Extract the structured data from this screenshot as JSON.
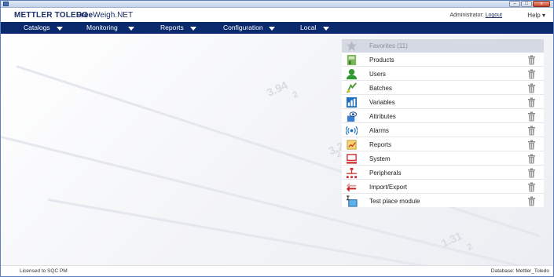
{
  "header": {
    "brand": "METTLER TOLEDO",
    "product_bold": "Free",
    "product_rest": "Weigh.NET",
    "user_label": "Administrator:",
    "logout": "Logout",
    "help": "Help"
  },
  "window_controls": {
    "minimize": "–",
    "maximize": "□",
    "close": "x"
  },
  "nav": {
    "items": [
      {
        "label": "Catalogs"
      },
      {
        "label": "Monitoring"
      },
      {
        "label": "Reports"
      },
      {
        "label": "Configuration"
      },
      {
        "label": "Local"
      }
    ]
  },
  "favorites": {
    "label": "Favorites (11)",
    "icon": "star-icon"
  },
  "modules": [
    {
      "label": "Products",
      "icon": "products-icon"
    },
    {
      "label": "Users",
      "icon": "user-icon"
    },
    {
      "label": "Batches",
      "icon": "batches-icon"
    },
    {
      "label": "Variables",
      "icon": "bar-chart-icon"
    },
    {
      "label": "Attributes",
      "icon": "attributes-icon"
    },
    {
      "label": "Alarms",
      "icon": "alarm-icon"
    },
    {
      "label": "Reports",
      "icon": "reports-icon"
    },
    {
      "label": "System",
      "icon": "system-icon"
    },
    {
      "label": "Peripherals",
      "icon": "peripherals-icon"
    },
    {
      "label": "Import/Export",
      "icon": "import-export-icon"
    },
    {
      "label": "Test place module",
      "icon": "test-place-icon"
    }
  ],
  "background_numbers": [
    "3.94",
    "2",
    "3.2",
    "2",
    "1.31",
    "2"
  ],
  "status": {
    "license": "Licensed to SQC PM",
    "database": "Database: Mettler_Toledo"
  },
  "colors": {
    "navbar": "#0b2a6e",
    "brand": "#1c2f66",
    "favorites_row": "#d5d9e3"
  }
}
